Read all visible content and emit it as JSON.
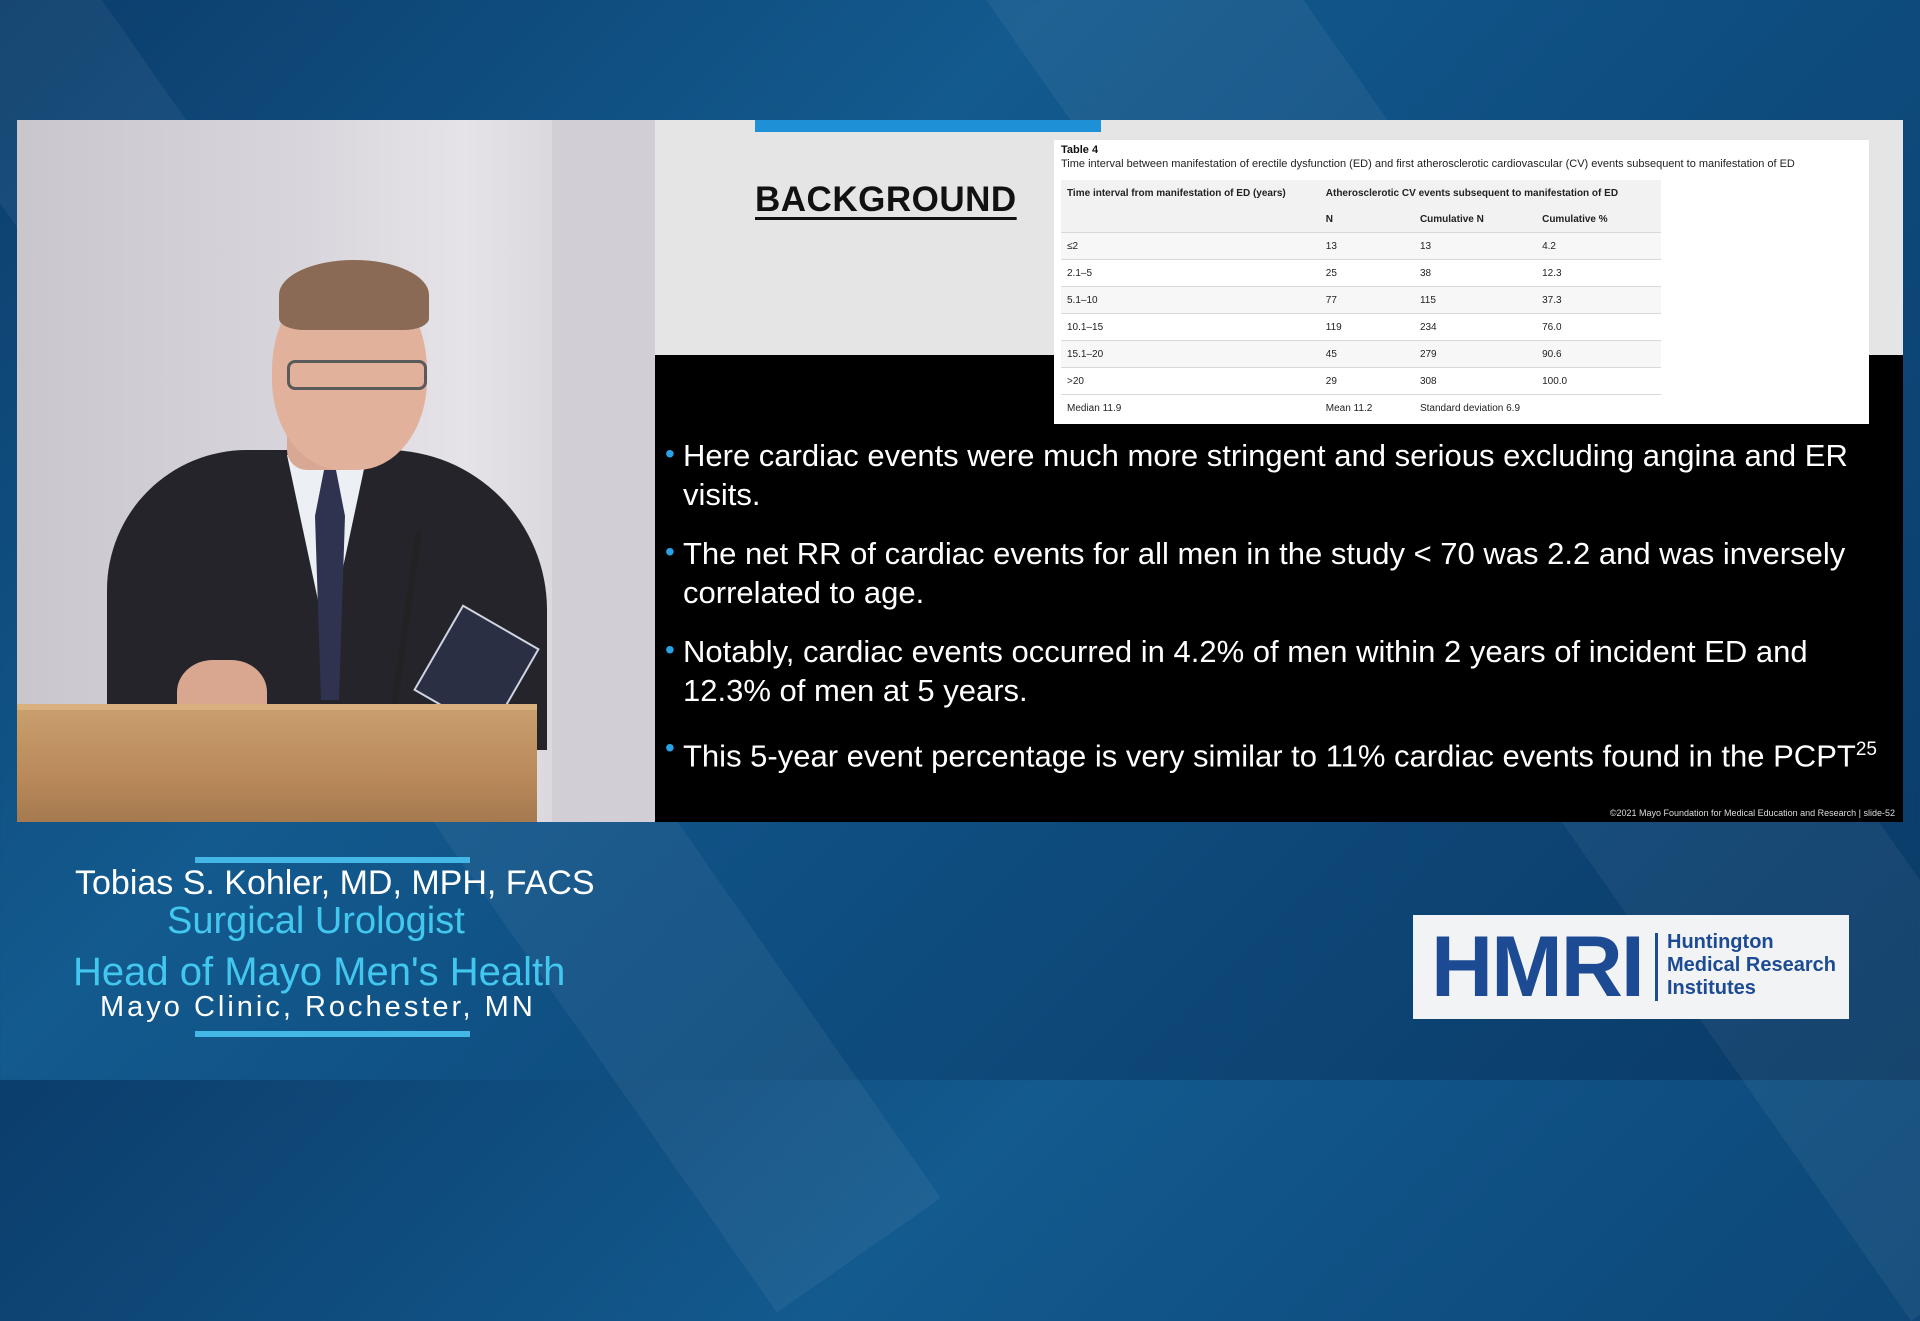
{
  "slide": {
    "title": "BACKGROUND",
    "table": {
      "label": "Table 4",
      "caption": "Time interval between manifestation of erectile dysfunction (ED) and first atherosclerotic cardiovascular (CV) events subsequent to manifestation of ED",
      "header_col1": "Time interval from manifestation of ED (years)",
      "header_group": "Atherosclerotic CV events subsequent to manifestation of ED",
      "sub_headers": [
        "N",
        "Cumulative N",
        "Cumulative %"
      ],
      "rows": [
        [
          "≤2",
          "13",
          "13",
          "4.2"
        ],
        [
          "2.1–5",
          "25",
          "38",
          "12.3"
        ],
        [
          "5.1–10",
          "77",
          "115",
          "37.3"
        ],
        [
          "10.1–15",
          "119",
          "234",
          "76.0"
        ],
        [
          "15.1–20",
          "45",
          "279",
          "90.6"
        ],
        [
          ">20",
          "29",
          "308",
          "100.0"
        ]
      ],
      "footer": [
        "Median 11.9",
        "Mean 11.2",
        "Standard deviation 6.9"
      ]
    },
    "bullets": [
      {
        "text": "Here cardiac events were much more stringent and serious excluding angina and ER visits."
      },
      {
        "text": " The net RR of cardiac events for all men in the study < 70 was 2.2 and was inversely correlated to age."
      },
      {
        "text": "Notably, cardiac events occurred in 4.2% of men within 2 years of incident ED and 12.3% of men at 5 years."
      },
      {
        "text": "This 5-year event percentage is very similar to 11% cardiac events found in the PCPT",
        "sup": "25"
      }
    ],
    "copyright": "©2021 Mayo Foundation for Medical Education and Research  |  slide-52"
  },
  "lower_third": {
    "name": "Tobias S. Kohler, MD, MPH, FACS",
    "role1": "Surgical Urologist",
    "role2": "Head of Mayo Men's Health",
    "institution": "Mayo Clinic, Rochester, MN"
  },
  "logo": {
    "mark": "HMRI",
    "line1": "Huntington",
    "line2": "Medical Research",
    "line3": "Institutes",
    "color": "#1d4b93"
  },
  "colors": {
    "accent": "#1e90d6",
    "lower_third_accent": "#42c7ef",
    "background": "#0f4f82"
  }
}
